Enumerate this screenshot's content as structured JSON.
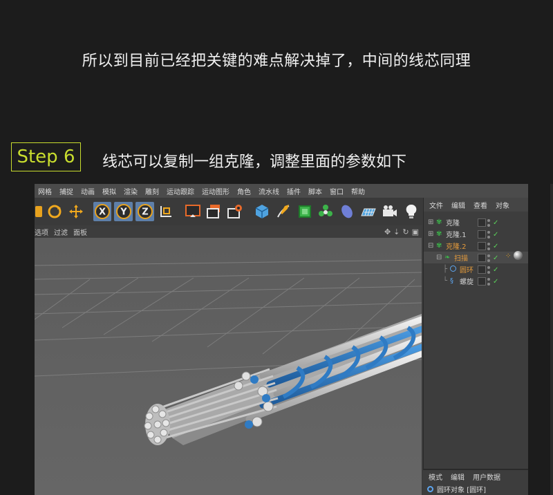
{
  "intro_text": "所以到目前已经把关键的难点解决掉了，中间的线芯同理",
  "step": {
    "label": "Step 6",
    "text": "线芯可以复制一组克隆，调整里面的参数如下"
  },
  "colors": {
    "accent": "#c9de2e",
    "selection": "#5e7fa9",
    "strand_blue": "#2f7bc4",
    "strand_white": "#d9d9d9"
  },
  "menu": [
    "网格",
    "捕捉",
    "动画",
    "模拟",
    "渲染",
    "雕刻",
    "运动跟踪",
    "运动图形",
    "角色",
    "流水线",
    "插件",
    "脚本",
    "窗口",
    "帮助"
  ],
  "toolbar_icons": [
    "rotate-tool-icon",
    "move-tool-icon",
    "x-axis-lock-icon",
    "y-axis-lock-icon",
    "z-axis-lock-icon",
    "coordinate-system-icon",
    "render-view-icon",
    "render-picture-queue-icon",
    "render-settings-icon",
    "cube-primitive-icon",
    "pen-spline-icon",
    "subdivision-icon",
    "cloner-icon",
    "deformer-icon",
    "floor-icon",
    "camera-icon",
    "light-icon"
  ],
  "viewport_menu": [
    "选项",
    "过滤",
    "面板"
  ],
  "object_manager": {
    "menu": [
      "文件",
      "编辑",
      "查看",
      "对象"
    ],
    "objects": [
      {
        "name": "克隆",
        "color": "#d8d8d8"
      },
      {
        "name": "克隆.1",
        "color": "#d8d8d8"
      },
      {
        "name": "克隆.2",
        "color": "#e39a3c"
      },
      {
        "name": "扫描",
        "color": "#e39a3c"
      },
      {
        "name": "圆环",
        "color": "#e39a3c"
      },
      {
        "name": "螺旋",
        "color": "#d8d8d8"
      }
    ]
  },
  "attributes": {
    "menu": [
      "模式",
      "编辑",
      "用户数据"
    ],
    "object_label": "圆环对象 [圆环]"
  }
}
